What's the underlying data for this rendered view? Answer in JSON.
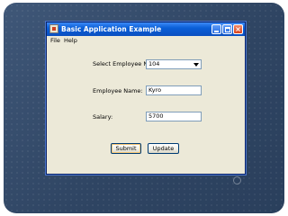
{
  "window": {
    "title": "Basic Application Example"
  },
  "menu": {
    "items": [
      "File",
      "Help"
    ]
  },
  "form": {
    "employee_no": {
      "label": "Select Employee No:",
      "selected": "104"
    },
    "employee_name": {
      "label": "Employee Name:",
      "value": "Kyro"
    },
    "salary": {
      "label": "Salary:",
      "value": "5700"
    }
  },
  "buttons": {
    "submit": "Submit",
    "update": "Update"
  },
  "colors": {
    "slide_background": "#2f4563",
    "titlebar": "#0a5fd8",
    "window_body": "#ece9d8",
    "close_button": "#d8421c"
  }
}
